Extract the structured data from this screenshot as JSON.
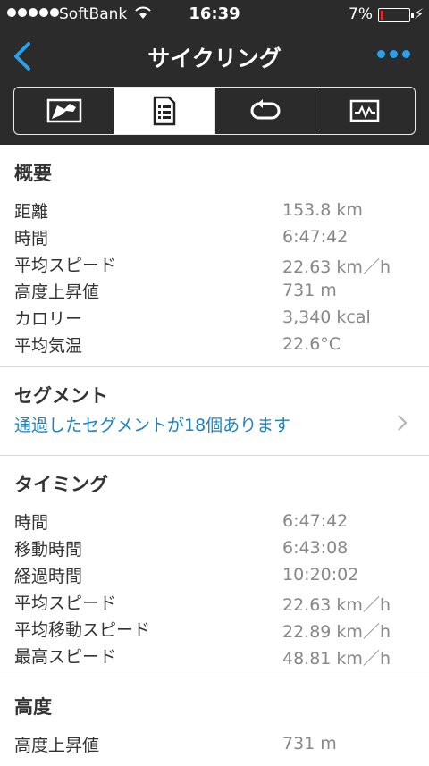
{
  "status": {
    "carrier": "SoftBank",
    "time": "16:39",
    "battery": "7%"
  },
  "nav": {
    "title": "サイクリング"
  },
  "tabs": [
    {
      "name": "map-tab-icon"
    },
    {
      "name": "details-tab-icon"
    },
    {
      "name": "laps-tab-icon"
    },
    {
      "name": "graph-tab-icon"
    }
  ],
  "summary": {
    "title": "概要",
    "rows": [
      {
        "label": "距離",
        "value": "153.8 km"
      },
      {
        "label": "時間",
        "value": "6:47:42"
      },
      {
        "label": "平均スピード",
        "value": "22.63 km／h"
      },
      {
        "label": "高度上昇値",
        "value": "731 m"
      },
      {
        "label": "カロリー",
        "value": "3,340 kcal"
      },
      {
        "label": "平均気温",
        "value": "22.6°C"
      }
    ]
  },
  "segments": {
    "title": "セグメント",
    "link": "通過したセグメントが18個あります"
  },
  "timing": {
    "title": "タイミング",
    "rows": [
      {
        "label": "時間",
        "value": "6:47:42"
      },
      {
        "label": "移動時間",
        "value": "6:43:08"
      },
      {
        "label": "経過時間",
        "value": "10:20:02"
      },
      {
        "label": "平均スピード",
        "value": "22.63 km／h"
      },
      {
        "label": "平均移動スピード",
        "value": "22.89 km／h"
      },
      {
        "label": "最高スピード",
        "value": "48.81 km／h"
      }
    ]
  },
  "elevation": {
    "title": "高度",
    "rows": [
      {
        "label": "高度上昇値",
        "value": "731 m"
      }
    ]
  },
  "colors": {
    "header": "#2b2b2b",
    "accent": "#2aa0ea",
    "link": "#1a84c6",
    "battery_low": "#e52b2b"
  }
}
